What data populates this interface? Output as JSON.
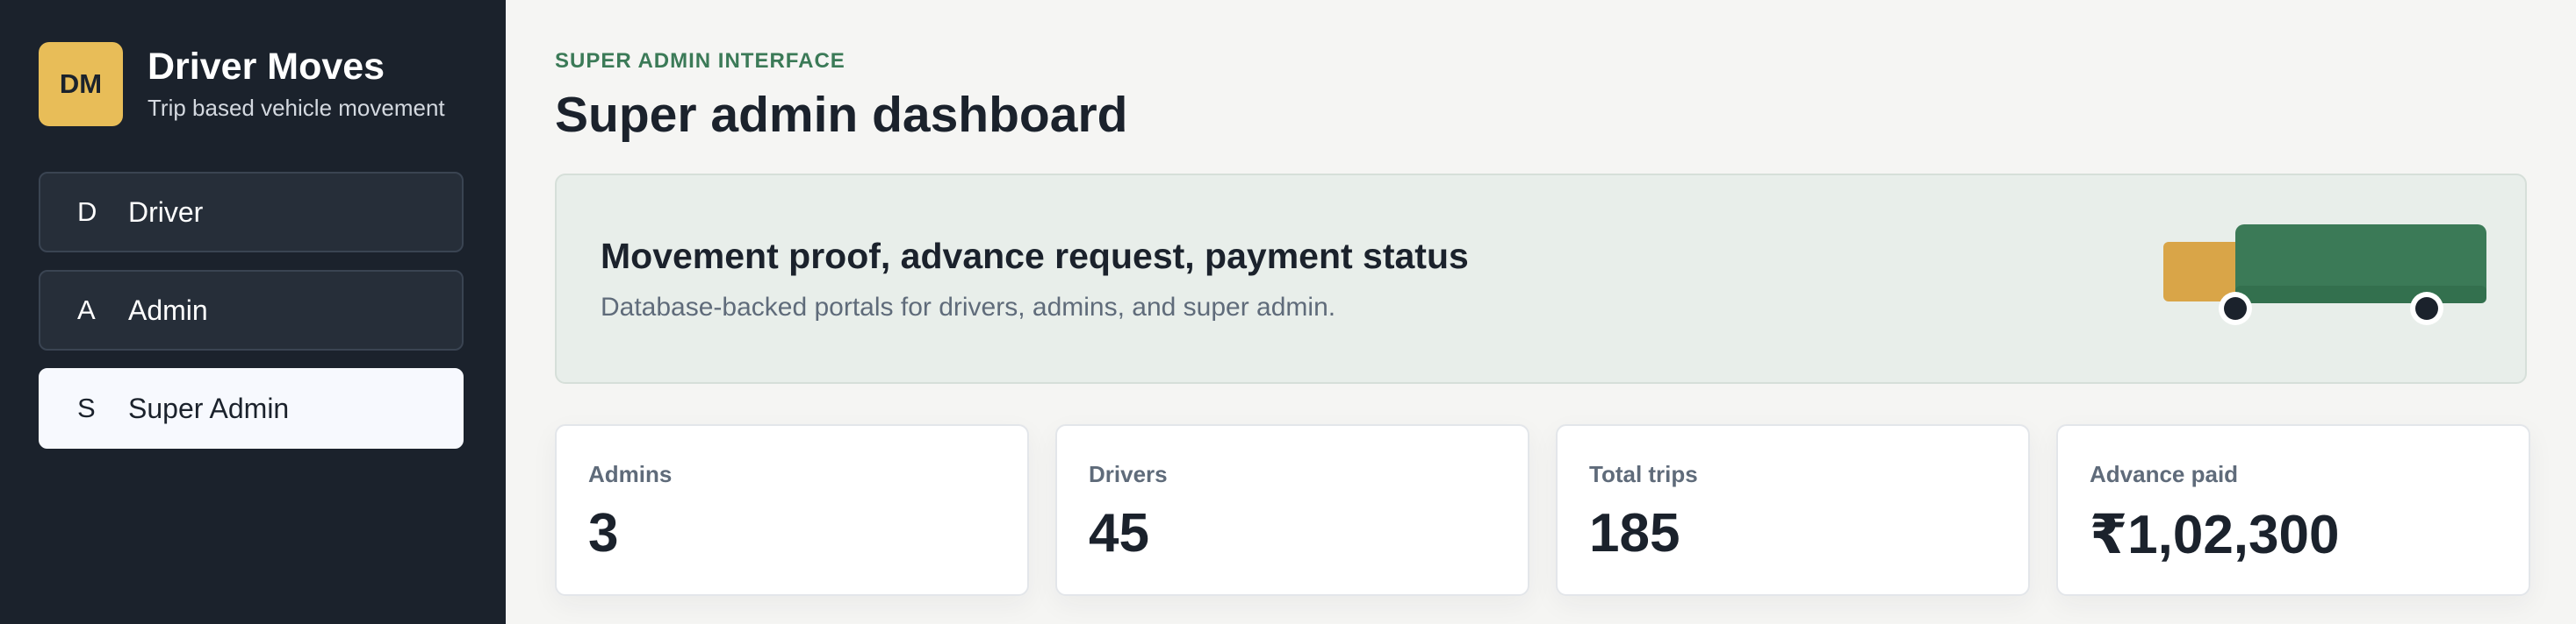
{
  "brand": {
    "initials": "DM",
    "title": "Driver Moves",
    "subtitle": "Trip based vehicle movement"
  },
  "nav": {
    "items": [
      {
        "letter": "D",
        "label": "Driver",
        "active": false
      },
      {
        "letter": "A",
        "label": "Admin",
        "active": false
      },
      {
        "letter": "S",
        "label": "Super Admin",
        "active": true
      }
    ]
  },
  "header": {
    "eyebrow": "SUPER ADMIN INTERFACE",
    "title": "Super admin dashboard"
  },
  "hero": {
    "title": "Movement proof, advance request, payment status",
    "subtitle": "Database-backed portals for drivers, admins, and super admin.",
    "illustration": "truck-icon"
  },
  "stats": [
    {
      "label": "Admins",
      "value": "3"
    },
    {
      "label": "Drivers",
      "value": "45"
    },
    {
      "label": "Total trips",
      "value": "185"
    },
    {
      "label": "Advance paid",
      "value": "₹1,02,300"
    }
  ],
  "colors": {
    "sidebar_bg": "#1b222c",
    "brand_accent": "#e8bd58",
    "eyebrow_green": "#3b7a57",
    "truck_green": "#3b7a57",
    "truck_cab": "#d9a548"
  }
}
